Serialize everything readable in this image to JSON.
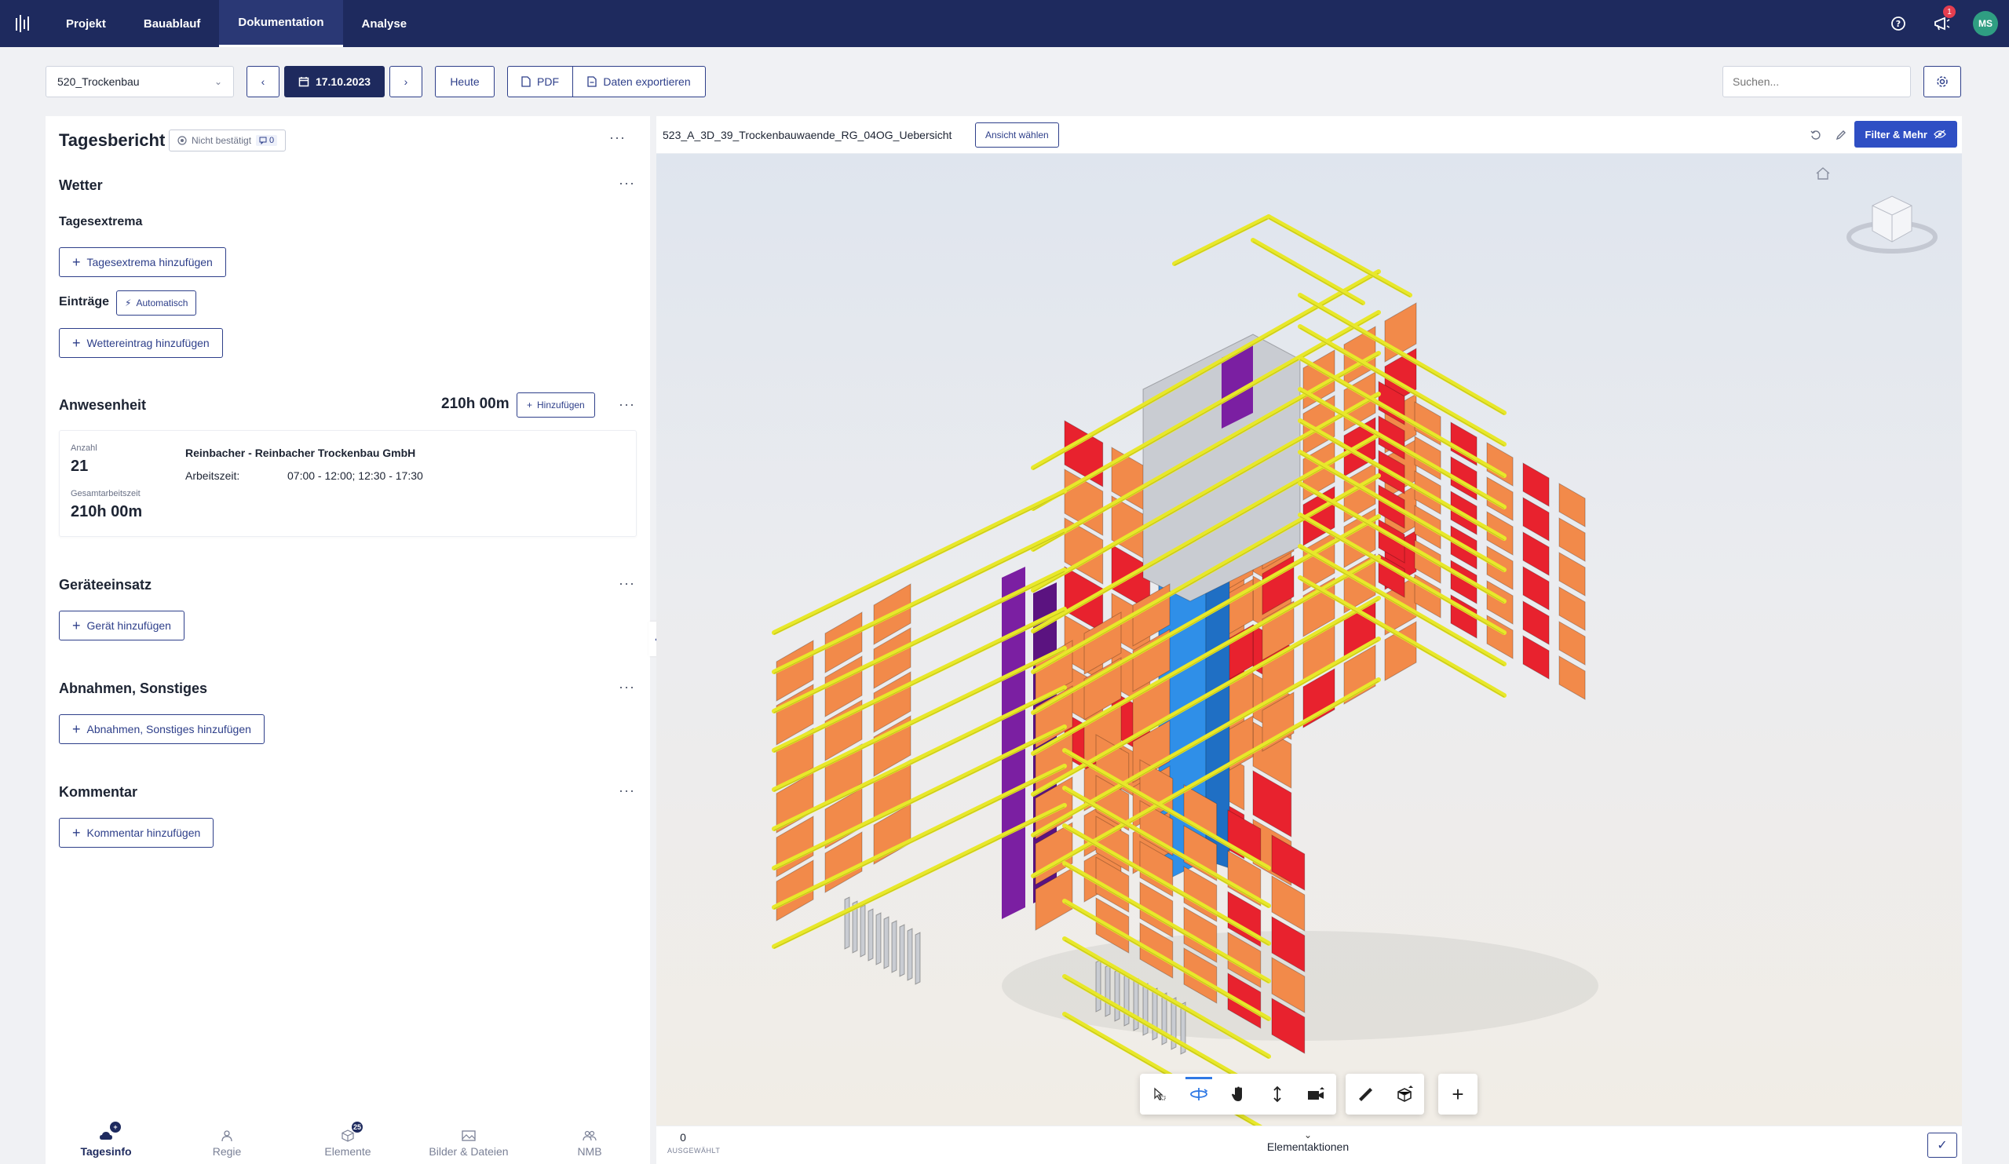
{
  "nav": {
    "items": [
      "Projekt",
      "Bauablauf",
      "Dokumentation",
      "Analyse"
    ],
    "active_index": 2,
    "notification_count": "1",
    "user_initials": "MS"
  },
  "toolbar": {
    "trade_select": "520_Trockenbau",
    "date": "17.10.2023",
    "today_label": "Heute",
    "pdf_label": "PDF",
    "export_label": "Daten exportieren",
    "search_placeholder": "Suchen..."
  },
  "report": {
    "title": "Tagesbericht",
    "status": "Nicht bestätigt",
    "comment_count": "0",
    "weather": {
      "title": "Wetter",
      "extrema_title": "Tagesextrema",
      "extrema_add": "Tagesextrema hinzufügen",
      "entries_title": "Einträge",
      "auto_label": "Automatisch",
      "entry_add": "Wettereintrag hinzufügen"
    },
    "attendance": {
      "title": "Anwesenheit",
      "total": "210h 00m",
      "add_label": "Hinzufügen",
      "count_label": "Anzahl",
      "count": "21",
      "total_time_label": "Gesamtarbeitszeit",
      "total_time": "210h 00m",
      "company": "Reinbacher - Reinbacher Trockenbau GmbH",
      "work_label": "Arbeitszeit:",
      "work_time": "07:00 - 12:00; 12:30 - 17:30"
    },
    "equipment": {
      "title": "Geräteeinsatz",
      "add": "Gerät hinzufügen"
    },
    "acceptance": {
      "title": "Abnahmen, Sonstiges",
      "add": "Abnahmen, Sonstiges hinzufügen"
    },
    "comment": {
      "title": "Kommentar",
      "add": "Kommentar hinzufügen"
    }
  },
  "bottom_tabs": [
    {
      "label": "Tagesinfo",
      "active": true
    },
    {
      "label": "Regie",
      "active": false
    },
    {
      "label": "Elemente",
      "active": false,
      "badge": "25"
    },
    {
      "label": "Bilder & Dateien",
      "active": false
    },
    {
      "label": "NMB",
      "active": false
    }
  ],
  "viewer": {
    "model_name": "523_A_3D_39_Trockenbauwaende_RG_04OG_Uebersicht",
    "view_button": "Ansicht wählen",
    "filter_button": "Filter & Mehr",
    "selected_count": "0",
    "selected_label": "AUSGEWÄHLT",
    "element_actions": "Elementaktionen",
    "colors": {
      "orange": "#f28a4a",
      "red": "#e8222e",
      "blue": "#2f8fe8",
      "purple": "#7b1fa2",
      "yellow": "#e8e82a",
      "grey": "#c9ccd2"
    }
  }
}
